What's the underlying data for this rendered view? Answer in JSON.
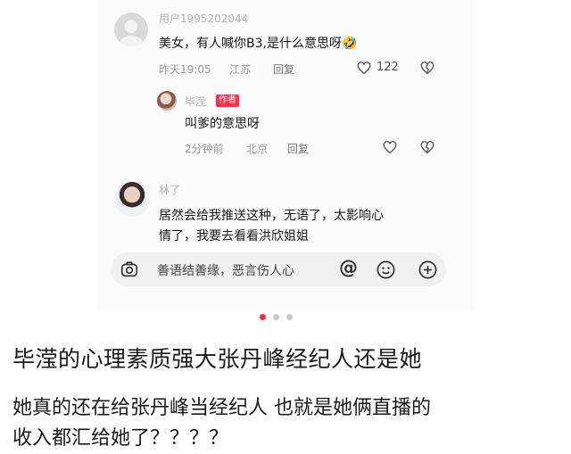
{
  "comments": [
    {
      "username": "用户1995202044",
      "text": "美女，有人喊你B3,是什么意思呀🤣",
      "time": "昨天19:05",
      "location": "江苏",
      "reply_label": "回复",
      "likes": "122"
    },
    {
      "username": "毕滢",
      "badge": "作者",
      "text": "叫爹的意思呀",
      "time": "2分钟前",
      "location": "北京",
      "reply_label": "回复"
    },
    {
      "username": "林了",
      "text_line1": "居然会给我推送这种，无语了，太影响心",
      "text_line2": "情了，我要去看看洪欣姐姐"
    }
  ],
  "input": {
    "placeholder": "善语结善缘，恶言伤人心"
  },
  "icons": {
    "camera": "camera-icon",
    "mention": "at-icon",
    "emoji": "emoji-icon",
    "add": "plus-icon",
    "like": "heart-icon",
    "dislike": "broken-heart-icon"
  },
  "pagination": {
    "count": 3,
    "active": 0,
    "active_color": "#ff2442"
  },
  "article": {
    "title": "毕滢的心理素质强大张丹峰经纪人还是她",
    "body_line1": "她真的还在给张丹峰当经纪人 也就是她俩直播的",
    "body_line2": "收入都汇给她了？？？？"
  }
}
